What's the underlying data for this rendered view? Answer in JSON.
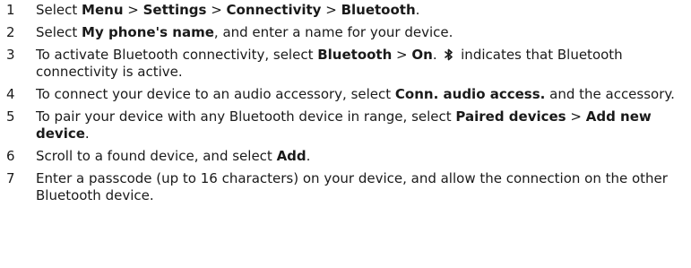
{
  "steps": [
    {
      "num": "1",
      "parts": [
        {
          "t": "Select "
        },
        {
          "t": "Menu",
          "b": true
        },
        {
          "t": " > "
        },
        {
          "t": "Settings",
          "b": true
        },
        {
          "t": " > "
        },
        {
          "t": "Connectivity",
          "b": true
        },
        {
          "t": " > "
        },
        {
          "t": "Bluetooth",
          "b": true
        },
        {
          "t": "."
        }
      ]
    },
    {
      "num": "2",
      "parts": [
        {
          "t": "Select "
        },
        {
          "t": "My phone's name",
          "b": true
        },
        {
          "t": ", and enter a name for your device."
        }
      ]
    },
    {
      "num": "3",
      "parts": [
        {
          "t": "To activate Bluetooth connectivity, select "
        },
        {
          "t": "Bluetooth",
          "b": true
        },
        {
          "t": " > "
        },
        {
          "t": "On",
          "b": true
        },
        {
          "t": ". "
        },
        {
          "icon": "bluetooth-icon"
        },
        {
          "t": " indicates that Bluetooth connectivity is active."
        }
      ]
    },
    {
      "num": "4",
      "parts": [
        {
          "t": "To connect your device to an audio accessory, select "
        },
        {
          "t": "Conn. audio access.",
          "b": true
        },
        {
          "t": " and the accessory."
        }
      ]
    },
    {
      "num": "5",
      "parts": [
        {
          "t": "To pair your device with any Bluetooth device in range, select "
        },
        {
          "t": "Paired devices",
          "b": true
        },
        {
          "t": " > "
        },
        {
          "t": "Add new device",
          "b": true
        },
        {
          "t": "."
        }
      ]
    },
    {
      "num": "6",
      "parts": [
        {
          "t": "Scroll to a found device, and select "
        },
        {
          "t": "Add",
          "b": true
        },
        {
          "t": "."
        }
      ]
    },
    {
      "num": "7",
      "parts": [
        {
          "t": "Enter a passcode (up to 16 characters) on your device, and allow the connection on the other Bluetooth device."
        }
      ]
    }
  ]
}
